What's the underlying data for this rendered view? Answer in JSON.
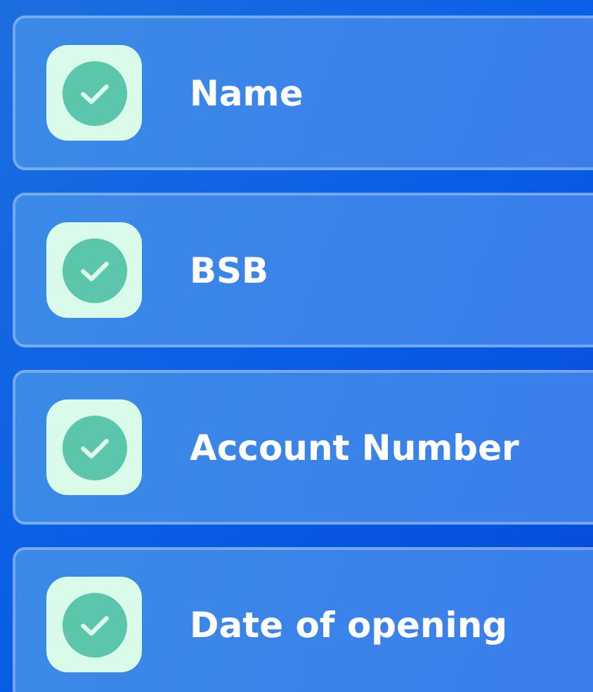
{
  "items": [
    {
      "label": "Name",
      "checked": true
    },
    {
      "label": "BSB",
      "checked": true
    },
    {
      "label": "Account Number",
      "checked": true
    },
    {
      "label": "Date of opening",
      "checked": true
    }
  ]
}
